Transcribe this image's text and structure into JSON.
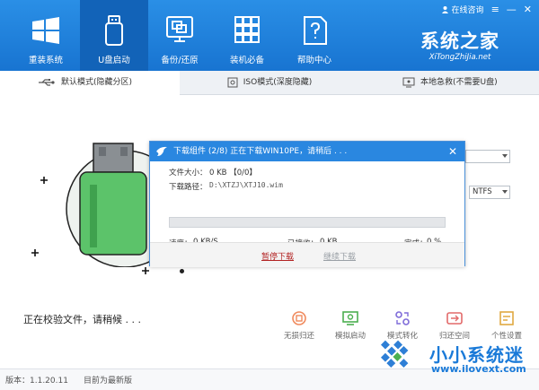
{
  "header": {
    "nav": [
      {
        "label": "重装系统",
        "icon": "windows-icon"
      },
      {
        "label": "U盘启动",
        "icon": "usb-drive-icon"
      },
      {
        "label": "备份/还原",
        "icon": "backup-icon"
      },
      {
        "label": "装机必备",
        "icon": "apps-grid-icon"
      },
      {
        "label": "帮助中心",
        "icon": "help-document-icon"
      }
    ],
    "consult_label": "在线咨询",
    "brand_name": "系统之家",
    "brand_url": "XiTongZhiJia.net"
  },
  "tabs": [
    {
      "label": "默认模式(隐藏分区)",
      "icon": "usb-icon"
    },
    {
      "label": "ISO模式(深度隐藏)",
      "icon": "disc-icon"
    },
    {
      "label": "本地急救(不需要U盘)",
      "icon": "local-rescue-icon"
    }
  ],
  "main": {
    "status_text": "正在校验文件，请稍候 . . .",
    "format_select": "NTFS",
    "tools": [
      {
        "label": "无损归还",
        "icon": "restore-icon"
      },
      {
        "label": "模拟启动",
        "icon": "simulate-boot-icon"
      },
      {
        "label": "模式转化",
        "icon": "mode-convert-icon"
      },
      {
        "label": "归还空间",
        "icon": "return-space-icon"
      },
      {
        "label": "个性设置",
        "icon": "personalize-icon"
      }
    ]
  },
  "dialog": {
    "title": "下载组件  (2/8)  正在下载WIN10PE，请稍后 . . .",
    "file_size_label": "文件大小：",
    "file_size_value": "0 KB 【0/0】",
    "path_label": "下载路径：",
    "path_value": "D:\\XTZJ\\XTJ10.wim",
    "speed_label": "速度：",
    "speed_value": "0 KB/S",
    "received_label": "已接收：",
    "received_value": "0 KB",
    "done_label": "完成：",
    "done_value": "0 %",
    "progress": 0,
    "pause_label": "暂停下载",
    "resume_label": "继续下载"
  },
  "footer": {
    "version": "版本：1.1.20.11",
    "latest": "目前为最新版"
  },
  "watermark": {
    "name": "小小系统迷",
    "url": "www.ilovext.com"
  },
  "colors": {
    "header": "#1874d1",
    "usb_green": "#5cc36a",
    "link_red": "#b22222",
    "accent_blue": "#2a87e0"
  }
}
